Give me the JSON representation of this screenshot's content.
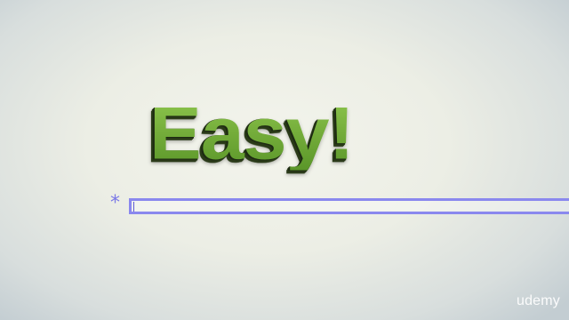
{
  "headline": {
    "text": "Easy!",
    "color": "#7cb342"
  },
  "prompt": {
    "symbol": "*",
    "color": "#7a78e6"
  },
  "input": {
    "value": "",
    "border_color": "#8a88ee"
  },
  "watermark": {
    "text": "udemy"
  }
}
